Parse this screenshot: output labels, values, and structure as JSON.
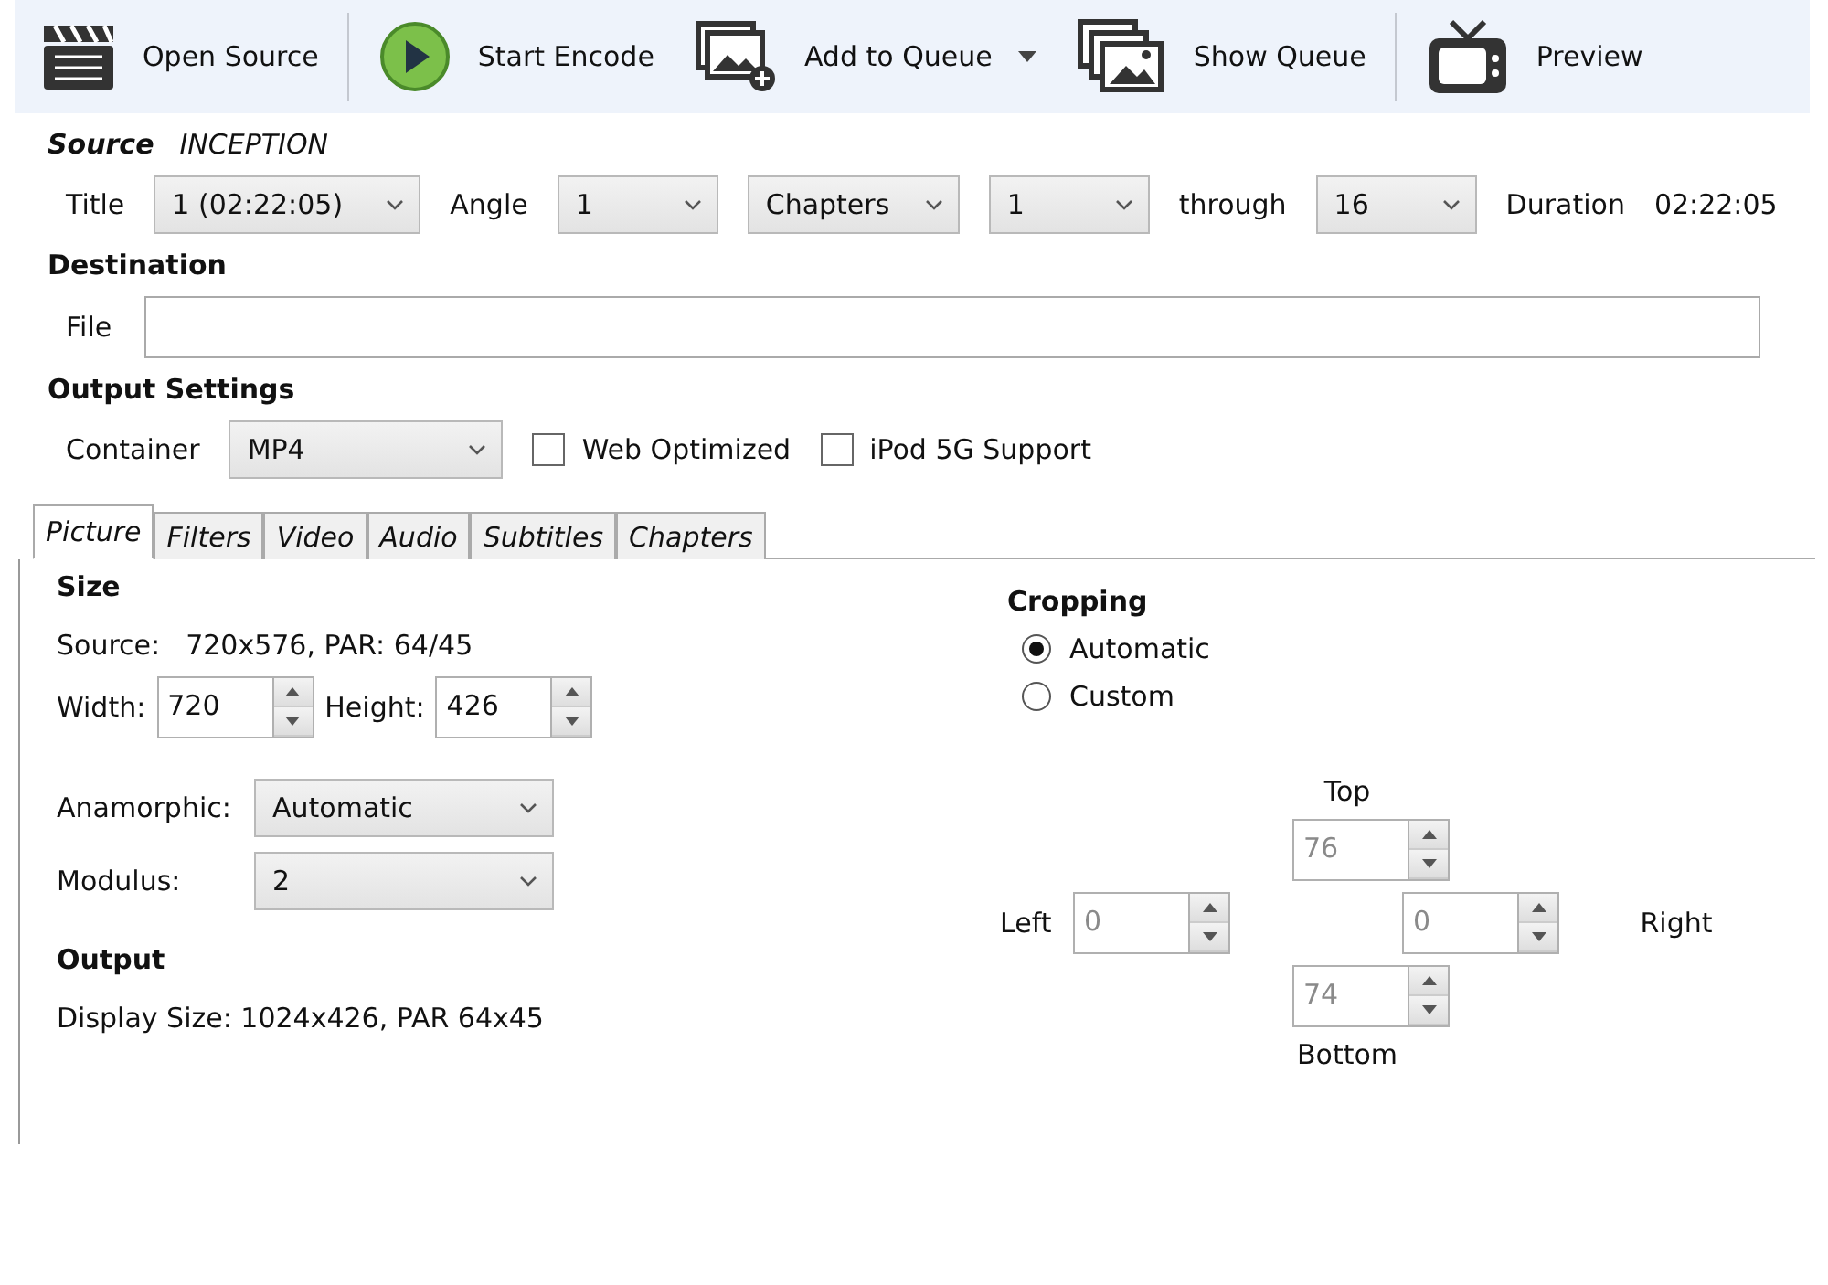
{
  "toolbar_groups": [
    [
      {
        "kind": "clapper",
        "label": "Open Source",
        "dropdown": false
      }
    ],
    [
      {
        "kind": "play",
        "label": "Start Encode",
        "dropdown": false
      },
      {
        "kind": "add-queue",
        "label": "Add to Queue",
        "dropdown": true
      },
      {
        "kind": "queue",
        "label": "Show Queue",
        "dropdown": false
      }
    ],
    [
      {
        "kind": "tv",
        "label": "Preview",
        "dropdown": false
      }
    ]
  ],
  "source": {
    "heading": "Source",
    "name": "INCEPTION",
    "title_label": "Title",
    "title_value": "1 (02:22:05)",
    "angle_label": "Angle",
    "angle_value": "1",
    "range_mode": "Chapters",
    "range_start": "1",
    "through_label": "through",
    "range_end": "16",
    "duration_label": "Duration",
    "duration_value": "02:22:05"
  },
  "destination": {
    "heading": "Destination",
    "file_label": "File"
  },
  "output_settings": {
    "heading": "Output Settings",
    "container_label": "Container",
    "container_value": "MP4",
    "options": [
      {
        "label": "Web Optimized",
        "checked": false
      },
      {
        "label": "iPod 5G Support",
        "checked": false
      }
    ]
  },
  "tabs": [
    {
      "label": "Picture",
      "selected": true
    },
    {
      "label": "Filters",
      "selected": false
    },
    {
      "label": "Video",
      "selected": false
    },
    {
      "label": "Audio",
      "selected": false
    },
    {
      "label": "Subtitles",
      "selected": false
    },
    {
      "label": "Chapters",
      "selected": false
    }
  ],
  "size": {
    "heading": "Size",
    "source_label": "Source:",
    "source_value": "720x576, PAR: 64/45",
    "width_label": "Width:",
    "width_value": "720",
    "height_label": "Height:",
    "height_value": "426",
    "anamorphic_label": "Anamorphic:",
    "anamorphic_value": "Automatic",
    "modulus_label": "Modulus:",
    "modulus_value": "2"
  },
  "output": {
    "heading": "Output",
    "display": "Display Size: 1024x426,  PAR 64x45"
  },
  "cropping": {
    "heading": "Cropping",
    "modes": [
      {
        "label": "Automatic",
        "selected": true
      },
      {
        "label": "Custom",
        "selected": false
      }
    ],
    "top": {
      "label": "Top",
      "value": "76",
      "disabled": true
    },
    "left": {
      "label": "Left",
      "value": "0",
      "disabled": true
    },
    "right": {
      "label": "Right",
      "value": "0",
      "disabled": true
    },
    "bottom": {
      "label": "Bottom",
      "value": "74",
      "disabled": true
    }
  }
}
